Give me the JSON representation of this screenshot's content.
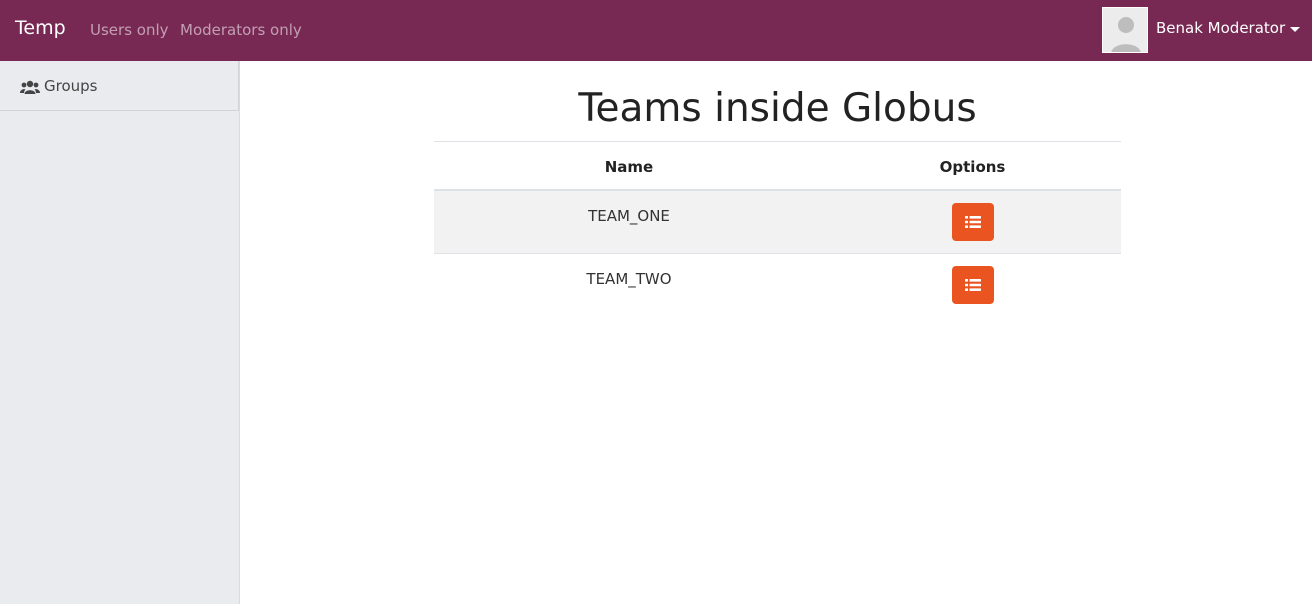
{
  "navbar": {
    "brand": "Temp",
    "links": [
      "Users only",
      "Moderators only"
    ],
    "user_name": "Benak Moderator",
    "background": "#772953"
  },
  "sidebar": {
    "items": [
      {
        "label": "Groups",
        "icon": "users-icon"
      }
    ]
  },
  "main": {
    "title": "Teams inside Globus",
    "table": {
      "columns": [
        "Name",
        "Options"
      ],
      "rows": [
        {
          "name": "TEAM_ONE",
          "option_icon": "list-icon"
        },
        {
          "name": "TEAM_TWO",
          "option_icon": "list-icon"
        }
      ]
    },
    "accent_color": "#e95420"
  }
}
